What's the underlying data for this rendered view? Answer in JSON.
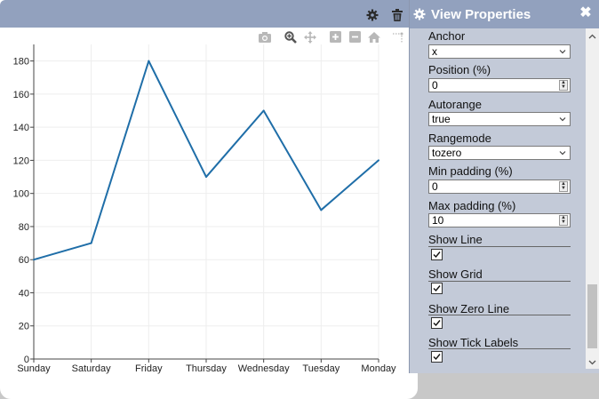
{
  "chart_data": {
    "type": "line",
    "categories": [
      "Sunday",
      "Saturday",
      "Friday",
      "Thursday",
      "Wednesday",
      "Tuesday",
      "Monday"
    ],
    "series": [
      {
        "values": [
          60,
          70,
          180,
          110,
          150,
          90,
          120
        ],
        "color": "#1f6ea8"
      }
    ],
    "title": "",
    "xlabel": "",
    "ylabel": "",
    "ylim": [
      0,
      190
    ],
    "yticks": [
      0,
      20,
      40,
      60,
      80,
      100,
      120,
      140,
      160,
      180
    ],
    "grid": true,
    "legend": "none"
  },
  "chart_header": {
    "icons": [
      "gear-icon",
      "trash-icon"
    ]
  },
  "modebar": {
    "icons": [
      "camera-icon",
      "zoom-icon",
      "pan-icon",
      "zoom-in-icon",
      "zoom-out-icon",
      "home-icon",
      "spike-lines-icon"
    ]
  },
  "properties": {
    "title": "View Properties",
    "close_glyph": "✖",
    "anchor": {
      "label": "Anchor",
      "value": "x"
    },
    "position": {
      "label": "Position (%)",
      "value": "0"
    },
    "autorange": {
      "label": "Autorange",
      "value": "true"
    },
    "rangemode": {
      "label": "Rangemode",
      "value": "tozero"
    },
    "min_padding": {
      "label": "Min padding (%)",
      "value": "0"
    },
    "max_padding": {
      "label": "Max padding (%)",
      "value": "10"
    },
    "show_line": {
      "label": "Show Line",
      "checked": true
    },
    "show_grid": {
      "label": "Show Grid",
      "checked": true
    },
    "show_zero_line": {
      "label": "Show Zero Line",
      "checked": true
    },
    "show_tick_labels": {
      "label": "Show Tick Labels",
      "checked": true
    }
  },
  "colors": {
    "header": "#92a1be",
    "panel": "#c3cad8",
    "line": "#1f6ea8"
  }
}
